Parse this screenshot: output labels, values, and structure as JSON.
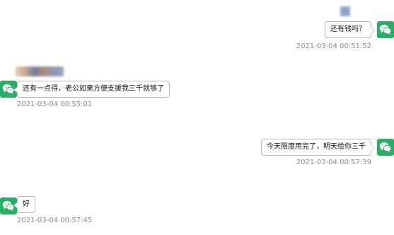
{
  "colors": {
    "avatar_green": "#2aae67",
    "bubble_border": "#b9b9b9",
    "timestamp": "#8c8c8c",
    "text": "#111111"
  },
  "avatar_icon": "wechat-icon",
  "messages": [
    {
      "side": "right",
      "text": "还有钱吗？",
      "timestamp": "2021-03-04 00:51:52"
    },
    {
      "side": "left",
      "text": "还有一点得，老公如果方便支援我三千就够了",
      "timestamp": "2021-03-04 00:55:01"
    },
    {
      "side": "right",
      "text": "今天限度用完了，明天给你三千",
      "timestamp": "2021-03-04 00:57:39"
    },
    {
      "side": "left",
      "text": "好",
      "timestamp": "2021-03-04 00:57:45"
    }
  ]
}
